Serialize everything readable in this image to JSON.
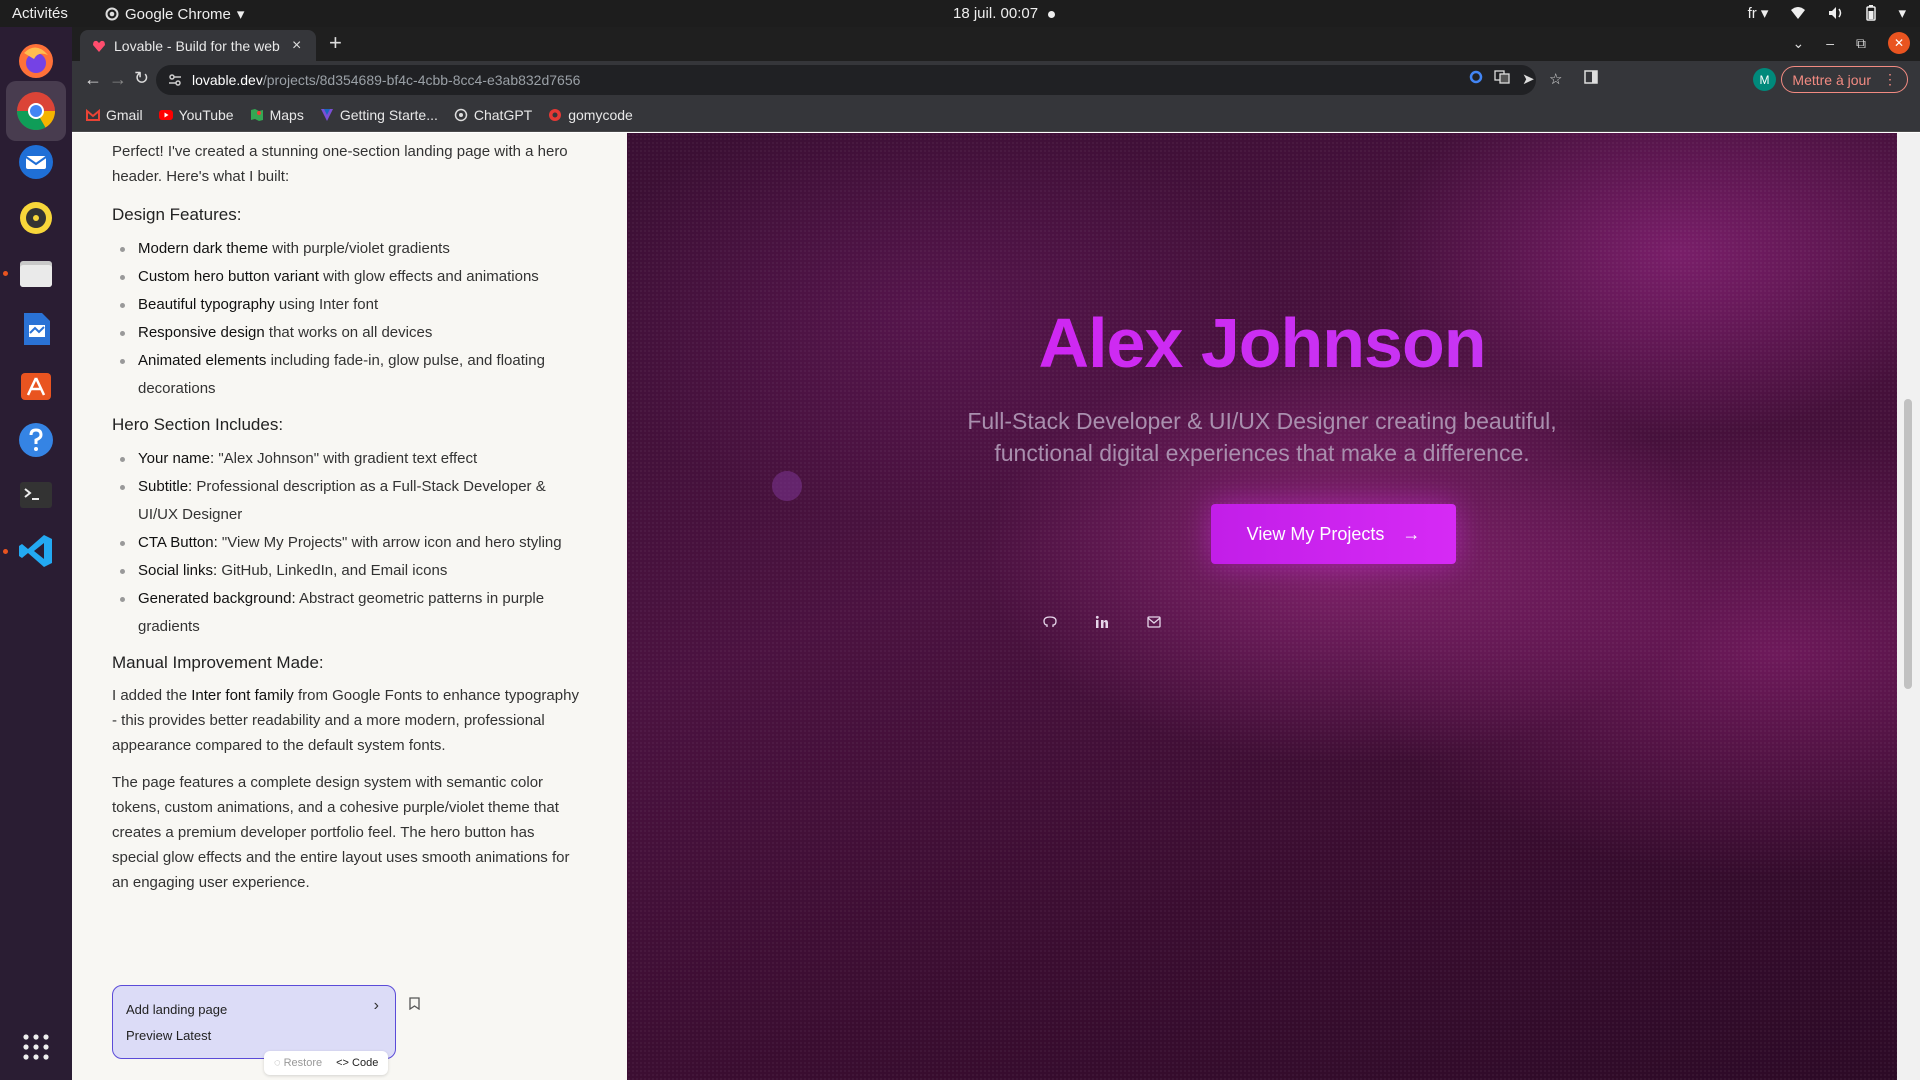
{
  "topbar": {
    "activities": "Activités",
    "app_name": "Google Chrome",
    "clock": "18 juil.  00:07",
    "lang": "fr"
  },
  "browser": {
    "tab_title": "Lovable - Build for the web",
    "url_domain": "lovable.dev",
    "url_path": "/projects/8d354689-bf4c-4cbb-8cc4-e3ab832d7656",
    "avatar_initial": "M",
    "update_label": "Mettre à jour",
    "bookmarks": [
      {
        "label": "Gmail",
        "icon": "gmail-icon"
      },
      {
        "label": "YouTube",
        "icon": "youtube-icon"
      },
      {
        "label": "Maps",
        "icon": "maps-icon"
      },
      {
        "label": "Getting Starte...",
        "icon": "vuetify-icon"
      },
      {
        "label": "ChatGPT",
        "icon": "chatgpt-icon"
      },
      {
        "label": "gomycode",
        "icon": "gomycode-icon"
      }
    ]
  },
  "chat": {
    "intro": "Perfect! I've created a stunning one-section landing page with a hero header. Here's what I built:",
    "design_heading": "Design Features:",
    "design_items": [
      {
        "bold": "Modern dark theme",
        "rest": " with purple/violet gradients"
      },
      {
        "bold": "Custom hero button variant",
        "rest": " with glow effects and animations"
      },
      {
        "bold": "Beautiful typography",
        "rest": " using Inter font"
      },
      {
        "bold": "Responsive design",
        "rest": " that works on all devices"
      },
      {
        "bold": "Animated elements",
        "rest": " including fade-in, glow pulse, and floating decorations"
      }
    ],
    "hero_heading": "Hero Section Includes:",
    "hero_items": [
      {
        "bold": "Your name:",
        "rest": " \"Alex Johnson\" with gradient text effect"
      },
      {
        "bold": "Subtitle:",
        "rest": " Professional description as a Full-Stack Developer & UI/UX Designer"
      },
      {
        "bold": "CTA Button:",
        "rest": " \"View My Projects\" with arrow icon and hero styling"
      },
      {
        "bold": "Social links:",
        "rest": " GitHub, LinkedIn, and Email icons"
      },
      {
        "bold": "Generated background:",
        "rest": " Abstract geometric patterns in purple gradients"
      }
    ],
    "manual_heading": "Manual Improvement Made:",
    "manual_pre": "I added the ",
    "manual_bold": "Inter font family",
    "manual_post": " from Google Fonts to enhance typography - this provides better readability and a more modern, professional appearance compared to the default system fonts.",
    "closing": "The page features a complete design system with semantic color tokens, custom animations, and a cohesive purple/violet theme that creates a premium developer portfolio feel. The hero button has special glow effects and the entire layout uses smooth animations for an engaging user experience.",
    "card_title": "Add landing page",
    "card_sub": "Preview Latest",
    "restore_label": "Restore",
    "code_label": "Code"
  },
  "preview": {
    "name": "Alex Johnson",
    "subtitle_line1": "Full-Stack Developer & UI/UX Designer creating beautiful,",
    "subtitle_line2": "functional digital experiences that make a difference.",
    "cta_label": "View My Projects"
  },
  "colors": {
    "accent": "#d61cf0",
    "cta": "#c21ee8",
    "card_border": "#5b4bd8"
  }
}
